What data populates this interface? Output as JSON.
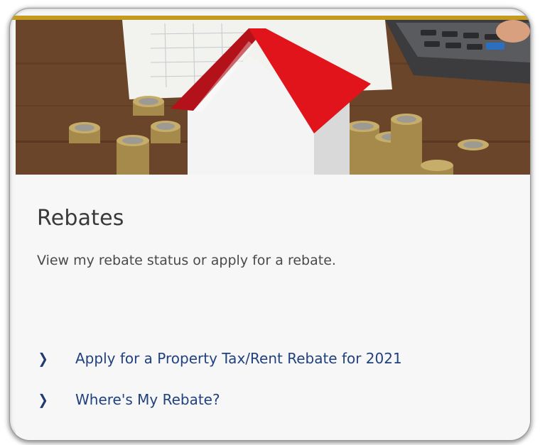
{
  "card": {
    "image_alt": "Model house with coins and calculator",
    "title": "Rebates",
    "description": "View my rebate status or apply for a rebate.",
    "links": [
      {
        "label": "Apply for a Property Tax/Rent Rebate for 2021",
        "icon": "chevron-right-icon"
      },
      {
        "label": "Where's My Rebate?",
        "icon": "chevron-right-icon"
      }
    ]
  },
  "colors": {
    "accent_gold": "#c49a1f",
    "link_blue": "#21417f",
    "roof_red": "#e1141b",
    "card_background": "#f7f7f7"
  }
}
